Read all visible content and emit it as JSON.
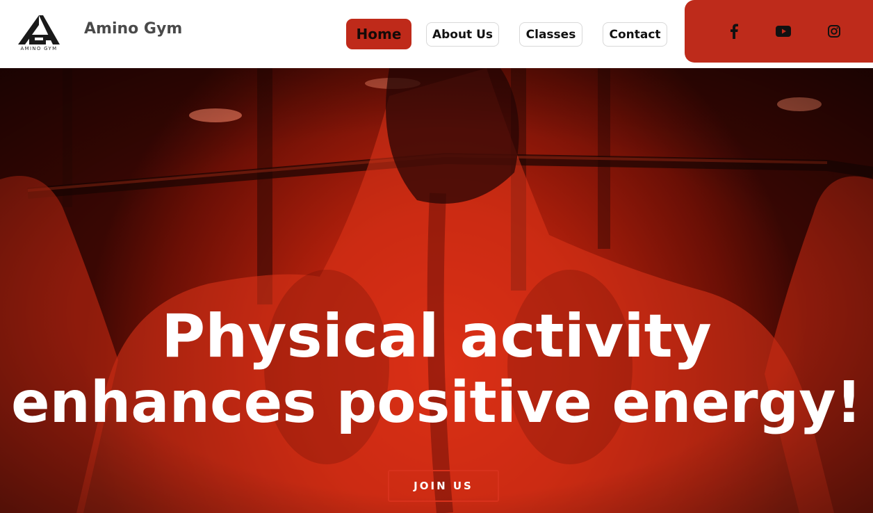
{
  "header": {
    "logo_caption": "AMINO GYM",
    "brand_name": "Amino Gym"
  },
  "nav": {
    "items": [
      {
        "label": "Home",
        "active": true
      },
      {
        "label": "About Us",
        "active": false
      },
      {
        "label": "Classes",
        "active": false
      },
      {
        "label": "Contact",
        "active": false
      }
    ]
  },
  "social": {
    "icons": [
      "facebook-icon",
      "youtube-icon",
      "instagram-icon"
    ]
  },
  "hero": {
    "title_line1": "Physical activity",
    "title_line2": "enhances positive energy!",
    "cta_label": "JOIN US"
  },
  "colors": {
    "accent": "#be2b1b",
    "nav_text": "#111111",
    "brand_text": "#4a4a4a",
    "hero_text": "#ffffff"
  }
}
